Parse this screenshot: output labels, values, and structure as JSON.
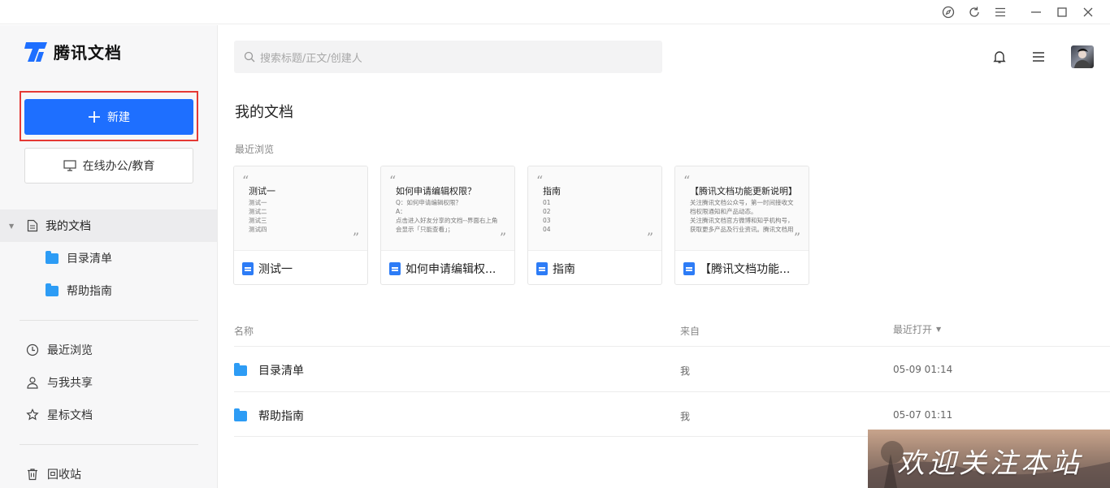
{
  "app": {
    "name": "腾讯文档"
  },
  "sidebar": {
    "new_label": "新建",
    "office_label": "在线办公/教育",
    "my_docs": "我的文档",
    "folders": [
      "目录清单",
      "帮助指南"
    ],
    "recent": "最近浏览",
    "shared": "与我共享",
    "starred": "星标文档",
    "trash": "回收站"
  },
  "search": {
    "placeholder": "搜索标题/正文/创建人"
  },
  "main": {
    "title": "我的文档",
    "recent_label": "最近浏览",
    "cards": [
      {
        "preview_title": "测试一",
        "preview_lines": [
          "测试一",
          "测试二",
          "测试三",
          "测试四"
        ],
        "name": "测试一",
        "icon": "doc-icon"
      },
      {
        "preview_title": "如何申请编辑权限？",
        "preview_lines": [
          "Q：如何申请编辑权限？",
          "A：",
          "点击进入好友分享的文档--界面右上角会显示「只能查看」；"
        ],
        "name": "如何申请编辑权...",
        "icon": "doc-share-icon"
      },
      {
        "preview_title": "指南",
        "preview_lines": [
          "01",
          "02",
          "03",
          "04"
        ],
        "name": "指南",
        "icon": "doc-icon"
      },
      {
        "preview_title": "【腾讯文档功能更新说明】",
        "preview_lines": [
          "关注腾讯文档公众号，第一时间接收文档权限通知和产品动态。",
          "关注腾讯文档官方微博和知乎机构号，获取更多产品及行业资讯。腾讯文档用"
        ],
        "name": "【腾讯文档功能...",
        "icon": "doc-share-icon"
      }
    ],
    "table": {
      "headers": {
        "name": "名称",
        "from": "来自",
        "opened": "最近打开"
      },
      "rows": [
        {
          "name": "目录清单",
          "from": "我",
          "opened": "05-09 01:14"
        },
        {
          "name": "帮助指南",
          "from": "我",
          "opened": "05-07 01:11"
        }
      ]
    }
  },
  "watermark": {
    "text": "欢迎关注本站"
  },
  "colors": {
    "primary": "#1e6fff",
    "highlight": "#e53935",
    "folder": "#2d9cf5"
  }
}
